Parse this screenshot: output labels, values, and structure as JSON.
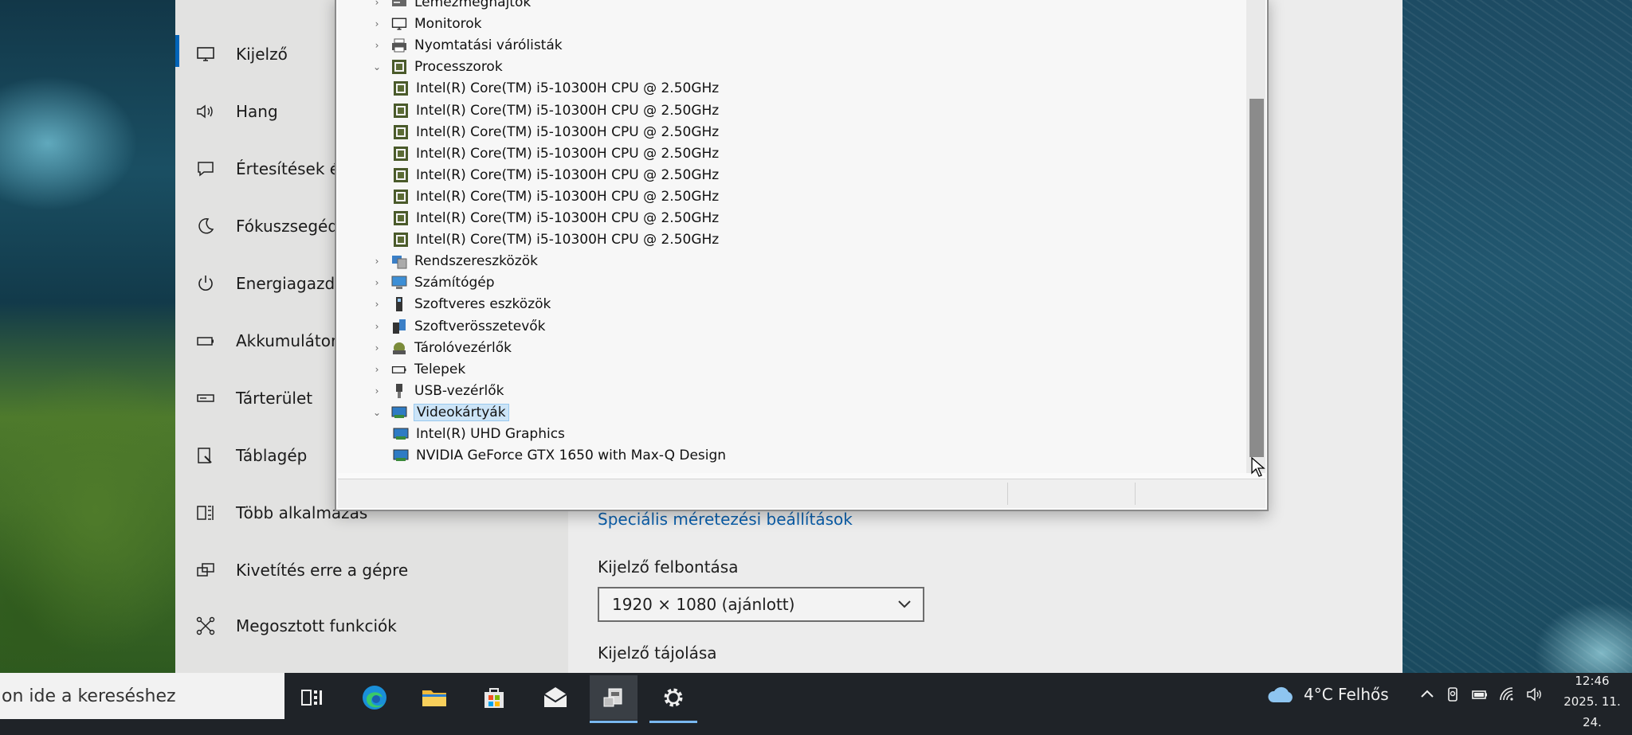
{
  "settings": {
    "sidebar": [
      {
        "label": "Kijelző",
        "icon": "monitor-icon"
      },
      {
        "label": "Hang",
        "icon": "speaker-icon"
      },
      {
        "label": "Értesítések és",
        "icon": "notification-icon"
      },
      {
        "label": "Fókuszsegéd",
        "icon": "moon-icon"
      },
      {
        "label": "Energiagazdá",
        "icon": "power-icon"
      },
      {
        "label": "Akkumulátor",
        "icon": "battery-icon"
      },
      {
        "label": "Tárterület",
        "icon": "storage-icon"
      },
      {
        "label": "Táblagép",
        "icon": "tablet-icon"
      },
      {
        "label": "Több alkalmazás",
        "icon": "multitasking-icon"
      },
      {
        "label": "Kivetítés erre a gépre",
        "icon": "project-icon"
      },
      {
        "label": "Megosztott funkciók",
        "icon": "shared-experiences-icon"
      }
    ],
    "advanced_link": "Speciális méretezési beállítások",
    "resolution_label": "Kijelző felbontása",
    "resolution_value": "1920 × 1080 (ajánlott)",
    "orientation_label": "Kijelző tájolása"
  },
  "device_manager": {
    "tree": [
      {
        "label": "Lemezmeghajtók",
        "level": 0,
        "expanded": false,
        "icon": "disk-icon"
      },
      {
        "label": "Monitorok",
        "level": 0,
        "expanded": false,
        "icon": "monitor-icon"
      },
      {
        "label": "Nyomtatási várólisták",
        "level": 0,
        "expanded": false,
        "icon": "printer-icon"
      },
      {
        "label": "Processzorok",
        "level": 0,
        "expanded": true,
        "icon": "cpu-icon"
      },
      {
        "label": "Intel(R) Core(TM) i5-10300H CPU @ 2.50GHz",
        "level": 1,
        "icon": "cpu-icon"
      },
      {
        "label": "Intel(R) Core(TM) i5-10300H CPU @ 2.50GHz",
        "level": 1,
        "icon": "cpu-icon"
      },
      {
        "label": "Intel(R) Core(TM) i5-10300H CPU @ 2.50GHz",
        "level": 1,
        "icon": "cpu-icon"
      },
      {
        "label": "Intel(R) Core(TM) i5-10300H CPU @ 2.50GHz",
        "level": 1,
        "icon": "cpu-icon"
      },
      {
        "label": "Intel(R) Core(TM) i5-10300H CPU @ 2.50GHz",
        "level": 1,
        "icon": "cpu-icon"
      },
      {
        "label": "Intel(R) Core(TM) i5-10300H CPU @ 2.50GHz",
        "level": 1,
        "icon": "cpu-icon"
      },
      {
        "label": "Intel(R) Core(TM) i5-10300H CPU @ 2.50GHz",
        "level": 1,
        "icon": "cpu-icon"
      },
      {
        "label": "Intel(R) Core(TM) i5-10300H CPU @ 2.50GHz",
        "level": 1,
        "icon": "cpu-icon"
      },
      {
        "label": "Rendszereszközök",
        "level": 0,
        "expanded": false,
        "icon": "system-devices-icon"
      },
      {
        "label": "Számítógép",
        "level": 0,
        "expanded": false,
        "icon": "computer-icon"
      },
      {
        "label": "Szoftveres eszközök",
        "level": 0,
        "expanded": false,
        "icon": "software-device-icon"
      },
      {
        "label": "Szoftverösszetevők",
        "level": 0,
        "expanded": false,
        "icon": "software-component-icon"
      },
      {
        "label": "Tárolóvezérlők",
        "level": 0,
        "expanded": false,
        "icon": "storage-controller-icon"
      },
      {
        "label": "Telepek",
        "level": 0,
        "expanded": false,
        "icon": "battery-icon"
      },
      {
        "label": "USB-vezérlők",
        "level": 0,
        "expanded": false,
        "icon": "usb-icon"
      },
      {
        "label": "Videokártyák",
        "level": 0,
        "expanded": true,
        "selected": true,
        "icon": "display-adapter-icon"
      },
      {
        "label": "Intel(R) UHD Graphics",
        "level": 1,
        "icon": "display-adapter-icon"
      },
      {
        "label": "NVIDIA GeForce GTX 1650 with Max-Q Design",
        "level": 1,
        "icon": "display-adapter-icon"
      }
    ]
  },
  "taskbar": {
    "search_placeholder": "on ide a kereséshez",
    "weather_text": "4°C  Felhős",
    "time": "12:46",
    "date": "2025. 11. 24."
  },
  "colors": {
    "accent": "#0064b8",
    "link": "#0b5fab",
    "selection": "#cce4f7",
    "taskbar": "#1f2328"
  }
}
